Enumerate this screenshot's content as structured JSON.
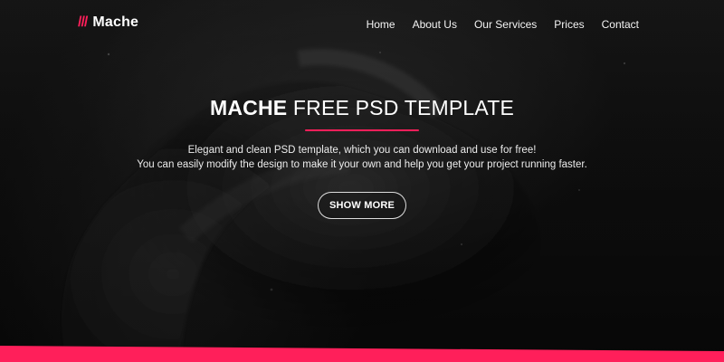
{
  "brand": {
    "mark": "///",
    "name": "Mache"
  },
  "nav": {
    "items": [
      {
        "label": "Home"
      },
      {
        "label": "About Us"
      },
      {
        "label": "Our Services"
      },
      {
        "label": "Prices"
      },
      {
        "label": "Contact"
      }
    ]
  },
  "hero": {
    "title_strong": "MACHE",
    "title_light": " FREE PSD TEMPLATE",
    "subtitle_line1": "Elegant and clean PSD template, which you can download and use for free!",
    "subtitle_line2": "You can easily modify the design to make it your own and help you get your project running faster.",
    "cta_label": "SHOW MORE"
  },
  "colors": {
    "accent": "#ff1f5a",
    "background": "#0f0f0f",
    "text": "#ffffff"
  },
  "icons": {
    "brand_mark": "triple-slash"
  }
}
